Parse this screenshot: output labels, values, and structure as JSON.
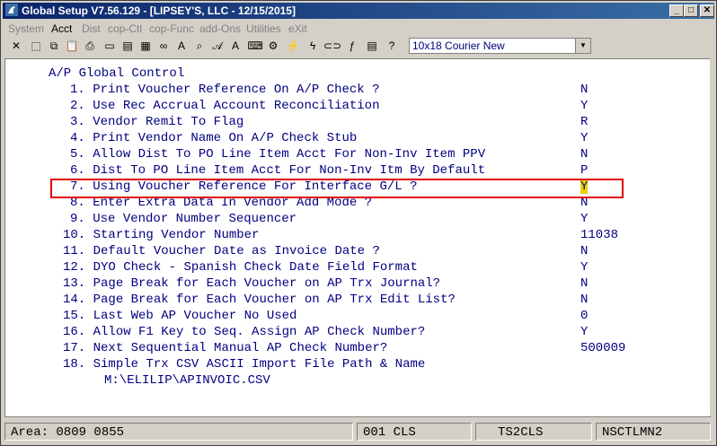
{
  "window": {
    "title": "Global Setup V7.56.129 - [LIPSEY'S, LLC - 12/15/2015]",
    "minimize": "_",
    "maximize": "□",
    "close": "✕"
  },
  "menu": [
    "System",
    "Acct",
    "Dist",
    "cop-Ctl",
    "cop-Func",
    "add-Ons",
    "Utilities",
    "eXit"
  ],
  "toolbar": {
    "font_select_value": "10x18 Courier New"
  },
  "screen": {
    "heading": "A/P Global Control",
    "items": [
      {
        "num": "1.",
        "label": "Print Voucher Reference On A/P Check ?",
        "value": "N"
      },
      {
        "num": "2.",
        "label": "Use Rec Accrual Account Reconciliation",
        "value": "Y"
      },
      {
        "num": "3.",
        "label": "Vendor Remit To Flag",
        "value": "R"
      },
      {
        "num": "4.",
        "label": "Print Vendor Name On A/P Check Stub",
        "value": "Y"
      },
      {
        "num": "5.",
        "label": "Allow Dist To PO Line Item Acct For Non-Inv Item PPV",
        "value": "N"
      },
      {
        "num": "6.",
        "label": "Dist To PO Line Item Acct For Non-Inv Itm By Default",
        "value": "P"
      },
      {
        "num": "7.",
        "label": "Using Voucher Reference For Interface G/L ?",
        "value": "Y"
      },
      {
        "num": "8.",
        "label": "Enter Extra Data In Vendor Add Mode ?",
        "value": "N"
      },
      {
        "num": "9.",
        "label": "Use Vendor Number Sequencer",
        "value": "Y"
      },
      {
        "num": "10.",
        "label": "Starting Vendor Number",
        "value": "11038"
      },
      {
        "num": "11.",
        "label": "Default Voucher Date as Invoice Date ?",
        "value": "N"
      },
      {
        "num": "12.",
        "label": "DYO Check - Spanish Check Date Field Format",
        "value": "Y"
      },
      {
        "num": "13.",
        "label": "Page Break for Each Voucher on AP Trx Journal?",
        "value": "N"
      },
      {
        "num": "14.",
        "label": "Page Break for Each Voucher on AP Trx Edit List?",
        "value": "N"
      },
      {
        "num": "15.",
        "label": "Last Web AP Voucher No Used",
        "value": "0"
      },
      {
        "num": "16.",
        "label": "Allow F1 Key to Seq. Assign AP Check Number?",
        "value": "Y"
      },
      {
        "num": "17.",
        "label": "Next Sequential Manual AP Check Number?",
        "value": "500009"
      },
      {
        "num": "18.",
        "label": "Simple Trx CSV ASCII Import File Path & Name",
        "value": ""
      }
    ],
    "path_value": "M:\\ELILIP\\APINVOIC.CSV"
  },
  "status": {
    "area": "Area: 0809 0855",
    "cls": "001 CLS",
    "ts": "TS2CLS",
    "prog": "NSCTLMN2"
  },
  "colors": {
    "title_bar": "#0a246a",
    "screen_text": "#000080",
    "highlight_border": "#e00000",
    "cursor": "#e8d400"
  }
}
